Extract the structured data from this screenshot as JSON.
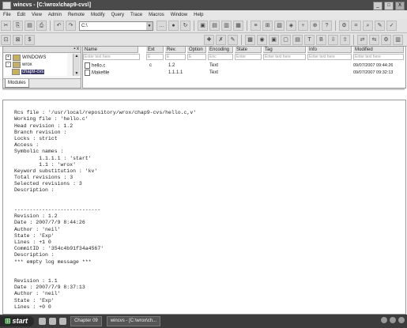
{
  "window": {
    "title": "wincvs - [C:\\wrox\\chap9-cvs\\]",
    "buttons": [
      "_",
      "□",
      "X"
    ]
  },
  "menu": [
    "File",
    "Edit",
    "View",
    "Admin",
    "Remote",
    "Modify",
    "Query",
    "Trace",
    "Macros",
    "Window",
    "Help"
  ],
  "toolbar": {
    "path_value": "C:\\",
    "toolbar1_icons": [
      "cut-icon",
      "copy-icon",
      "paste-icon",
      "print-icon",
      "undo-icon",
      "redo-icon"
    ],
    "toolbar1_right_icons": [
      "browse-icon",
      "stop-icon",
      "refresh-icon",
      "checkout-icon",
      "update-icon",
      "commit-icon",
      "diff-icon",
      "log-icon",
      "graph-icon",
      "annotate-icon",
      "tag-icon",
      "branch-icon",
      "merge-icon",
      "status-icon",
      "help-icon"
    ],
    "toolbar2_left_icons": [
      "filter-icon",
      "ignore-icon",
      "dollar-icon"
    ],
    "toolbar2_right_icons": [
      "add-icon",
      "remove-icon",
      "edit-icon",
      "unedit-icon",
      "watch-icon",
      "lock-icon",
      "unlock-icon",
      "release-icon",
      "text-icon",
      "binary-icon",
      "import-icon",
      "export-icon",
      "compare-icon",
      "settings-icon"
    ]
  },
  "tree": {
    "nodes": [
      {
        "label": "WINDOWS",
        "expander": "+"
      },
      {
        "label": "wrox",
        "expander": "-"
      },
      {
        "label": "chap9-cvs",
        "expander": ""
      }
    ],
    "tab_label": "Modules"
  },
  "files": {
    "columns": [
      "Name",
      "Ext",
      "Rev.",
      "Option",
      "Encoding",
      "State",
      "Tag",
      "Info",
      "Modified"
    ],
    "filters": [
      "Enter text here",
      "E",
      "E",
      "E",
      "Enc",
      "Enter",
      "Enter text here",
      "Enter text here",
      "Enter text here"
    ],
    "rows": [
      {
        "name": "hello.c",
        "ext": "c",
        "rev": "1.2",
        "option": "",
        "encoding": "Text",
        "state": "",
        "tag": "",
        "info": "",
        "modified": "09/07/2007 09:44:26"
      },
      {
        "name": "Makefile",
        "ext": "",
        "rev": "1.1.1.1",
        "option": "",
        "encoding": "Text",
        "state": "",
        "tag": "",
        "info": "",
        "modified": "09/07/2007 09:32:13"
      }
    ]
  },
  "output": {
    "lines": [
      "",
      "Rcs file : '/usr/local/repository/wrox/chap9-cvs/hello.c,v'",
      "Working file : 'hello.c'",
      "Head revision : 1.2",
      "Branch revision :",
      "Locks : strict",
      "Access :",
      "Symbolic names :",
      "        1.1.1.1 : 'start'",
      "        1.1 : 'wrox'",
      "Keyword substitution : 'kv'",
      "Total revisions : 3",
      "Selected revisions : 3",
      "Description :",
      "",
      "",
      "----------------------------",
      "Revision : 1.2",
      "Date : 2007/7/9 8:44:26",
      "Author : 'neil'",
      "State : 'Exp'",
      "Lines : +1 0",
      "CommitID : '354c4b91f34a4567'",
      "Description :",
      "*** empty log message ***",
      "",
      "",
      "Revision : 1.1",
      "Date : 2007/7/9 8:37:13",
      "Author : 'neil'",
      "State : 'Exp'",
      "Lines : +0 0"
    ]
  },
  "taskbar": {
    "start_label": "start",
    "tasks": [
      "Chapter 09",
      "wincvs - [C:\\wrox\\ch..."
    ]
  }
}
